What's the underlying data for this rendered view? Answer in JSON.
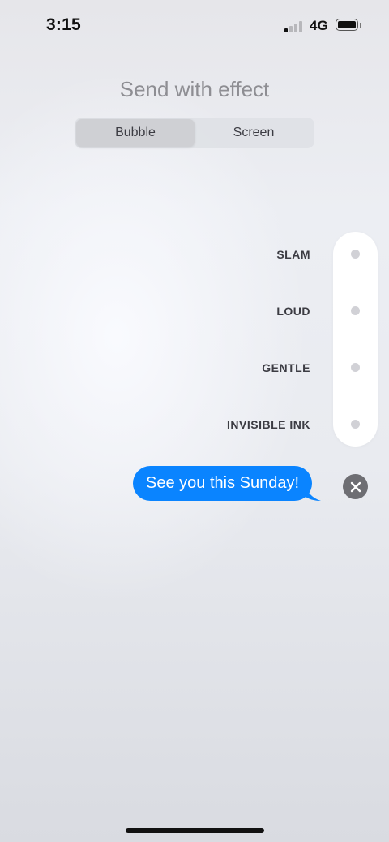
{
  "status_bar": {
    "time": "3:15",
    "network": "4G",
    "signal_bars_active": 1,
    "signal_bars_total": 4,
    "battery_level": 0.9,
    "icons": [
      "cellular-signal-icon",
      "battery-icon"
    ]
  },
  "header": {
    "title": "Send with effect",
    "tabs": [
      {
        "label": "Bubble",
        "selected": true
      },
      {
        "label": "Screen",
        "selected": false
      }
    ]
  },
  "effects": {
    "items": [
      {
        "label": "SLAM"
      },
      {
        "label": "LOUD"
      },
      {
        "label": "GENTLE"
      },
      {
        "label": "INVISIBLE INK"
      }
    ]
  },
  "message": {
    "text": "See you this Sunday!",
    "close_icon": "close-icon"
  },
  "colors": {
    "bubble": "#0a84ff",
    "bubble_text": "#ffffff",
    "title": "#8e8e93",
    "effect_dot": "#d1d1d6",
    "close_button": "#6e6e73"
  }
}
